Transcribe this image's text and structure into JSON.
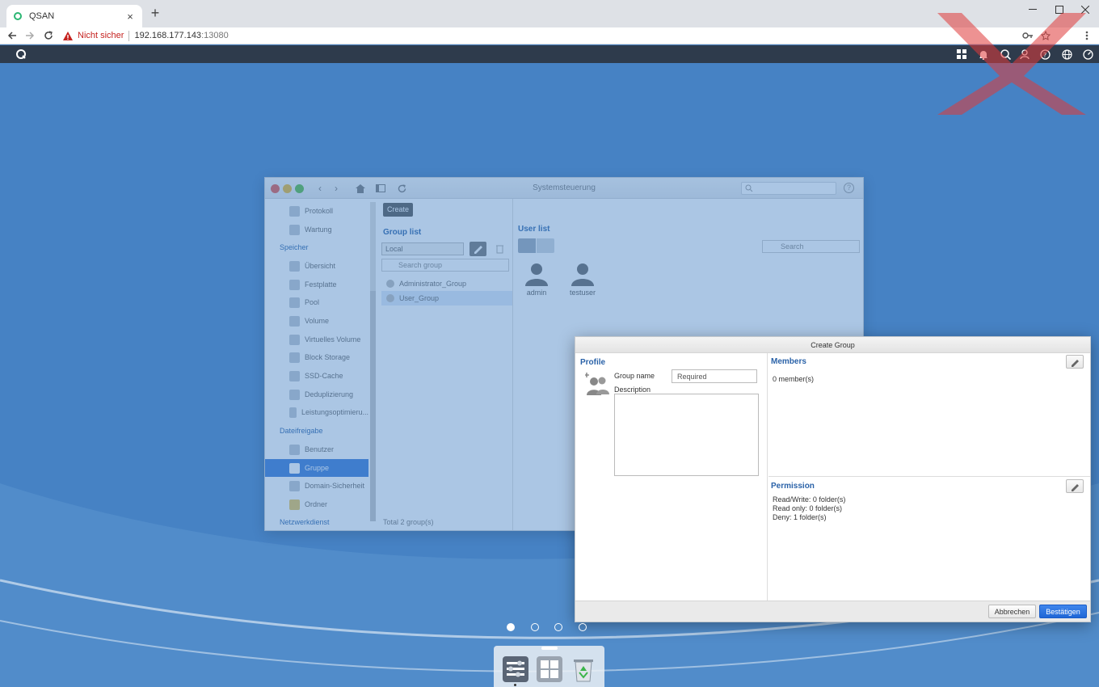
{
  "browser": {
    "tab_title": "QSAN",
    "security_warning": "Nicht sicher",
    "url_host": "192.168.177.143",
    "url_port": ":13080",
    "icons": [
      "back-arrow-icon",
      "forward-arrow-icon",
      "reload-icon",
      "warning-icon",
      "key-icon",
      "star-icon",
      "menu-dots-icon"
    ]
  },
  "control_panel": {
    "title": "Systemsteuerung",
    "sidebar": {
      "items_top": [
        {
          "label": "Protokoll",
          "icon": "log-icon"
        },
        {
          "label": "Wartung",
          "icon": "tools-icon"
        }
      ],
      "sections": [
        {
          "title": "Speicher",
          "items": [
            "Übersicht",
            "Festplatte",
            "Pool",
            "Volume",
            "Virtuelles Volume",
            "Block Storage",
            "SSD-Cache",
            "Deduplizierung",
            "Leistungsoptimieru..."
          ]
        },
        {
          "title": "Dateifreigabe",
          "items": [
            "Benutzer",
            "Gruppe",
            "Domain-Sicherheit",
            "Ordner"
          ]
        },
        {
          "title": "Netzwerkdienst",
          "items": []
        }
      ],
      "selected": "Gruppe"
    },
    "create_label": "Create",
    "group_list": {
      "heading": "Group list",
      "scope": "Local",
      "search_placeholder": "Search group",
      "groups": [
        "Administrator_Group",
        "User_Group"
      ],
      "total": "Total 2 group(s)"
    },
    "user_list": {
      "heading": "User list",
      "search_placeholder": "Search",
      "users": [
        "admin",
        "testuser"
      ]
    }
  },
  "dialog": {
    "title": "Create Group",
    "profile": {
      "heading": "Profile",
      "group_name_label": "Group name",
      "group_name_placeholder": "Required",
      "description_label": "Description"
    },
    "members": {
      "heading": "Members",
      "count": "0 member(s)"
    },
    "permission": {
      "heading": "Permission",
      "read_write": "Read/Write: 0 folder(s)",
      "read_only": "Read only: 0 folder(s)",
      "deny": "Deny: 1 folder(s)"
    },
    "cancel_label": "Abbrechen",
    "confirm_label": "Bestätigen"
  },
  "desktop": {
    "pages": 4,
    "active_page": 1,
    "dock_apps": [
      "control-panel-app-icon",
      "app-grid-icon",
      "recycle-bin-icon"
    ]
  },
  "colors": {
    "accent": "#2a62a8",
    "primary_button": "#1f66d6",
    "desktop_blue": "#4682c4",
    "topbar": "#2e3b4c"
  }
}
